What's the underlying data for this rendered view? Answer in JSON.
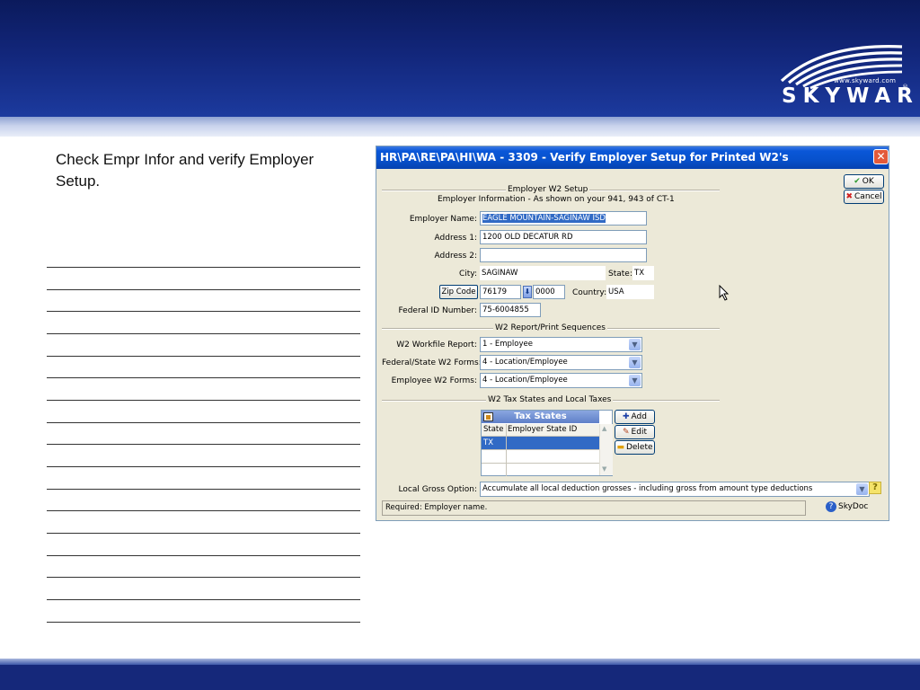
{
  "brand": {
    "url": "www.skyward.com",
    "name": "SKYWARD",
    "reg": "®"
  },
  "instruction": "Check Empr Infor and verify Employer Setup.",
  "dialog": {
    "title": "HR\\PA\\RE\\PA\\HI\\WA - 3309 - Verify Employer Setup for Printed W2's",
    "close_symbol": "✕",
    "ok_label": "OK",
    "cancel_label": "Cancel",
    "section_setup": "Employer W2 Setup",
    "section_setup_sub": "Employer Information - As shown on your 941, 943 of CT-1",
    "employer_name_label": "Employer Name:",
    "employer_name": "EAGLE MOUNTAIN-SAGINAW ISD",
    "address1_label": "Address 1:",
    "address1": "1200 OLD DECATUR RD",
    "address2_label": "Address 2:",
    "address2": "",
    "city_label": "City:",
    "city": "SAGINAW",
    "state_label": "State:",
    "state": "TX",
    "zip_button": "Zip Code",
    "zip": "76179",
    "zip_ext": "0000",
    "country_label": "Country:",
    "country": "USA",
    "federal_id_label": "Federal ID Number:",
    "federal_id": "75-6004855",
    "section_report": "W2 Report/Print Sequences",
    "workfile_label": "W2 Workfile Report:",
    "workfile_value": "1 - Employee",
    "fedstate_label": "Federal/State W2 Forms:",
    "fedstate_value": "4 - Location/Employee",
    "employee_forms_label": "Employee W2 Forms:",
    "employee_forms_value": "4 - Location/Employee",
    "section_tax": "W2 Tax States and Local Taxes",
    "grid_title": "Tax States",
    "grid_col_state": "State",
    "grid_col_id": "Employer State ID",
    "grid_rows": [
      {
        "state": "TX",
        "id": ""
      }
    ],
    "add_label": "Add",
    "edit_label": "Edit",
    "delete_label": "Delete",
    "local_gross_label": "Local Gross Option:",
    "local_gross_value": "Accumulate all local deduction grosses - including gross from amount type deductions",
    "status_text": "Required: Employer name.",
    "skydoc_label": "SkyDoc"
  },
  "colors": {
    "header": "#12267a",
    "title_bar": "#0751cc",
    "dialog_bg": "#ece9d8",
    "selection": "#316ac5"
  }
}
